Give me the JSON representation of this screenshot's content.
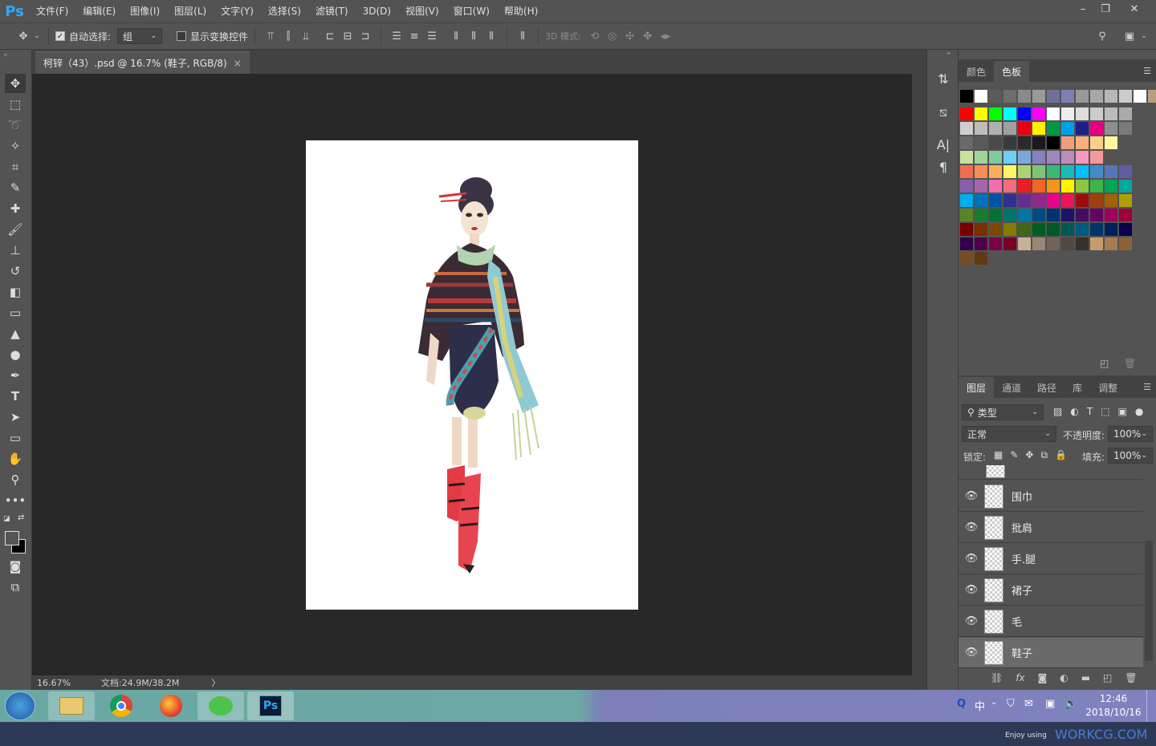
{
  "app": {
    "logo": "Ps"
  },
  "menubar": {
    "items": [
      "文件(F)",
      "编辑(E)",
      "图像(I)",
      "图层(L)",
      "文字(Y)",
      "选择(S)",
      "滤镜(T)",
      "3D(D)",
      "视图(V)",
      "窗口(W)",
      "帮助(H)"
    ]
  },
  "window_controls": {
    "minimize": "–",
    "restore": "❐",
    "close": "✕"
  },
  "options": {
    "auto_select_label": "自动选择:",
    "auto_select_value": "组",
    "show_transform_label": "显示变换控件",
    "mode_3d_label": "3D 模式:"
  },
  "document": {
    "tab_title": "柯锌（43）.psd @ 16.7% (鞋子, RGB/8)",
    "close": "×"
  },
  "status": {
    "zoom": "16.67%",
    "doc_info": "文档:24.9M/38.2M",
    "arrow": "〉"
  },
  "swatch_panel": {
    "tabs": [
      "颜色",
      "色板"
    ],
    "active_tab": "色板",
    "colors": [
      [
        "#000000",
        "#ffffff",
        "#5a5a5a",
        "#6e6e6e",
        "#8a8a8a",
        "#9a9a9a",
        "#6f6f9a",
        "#7e7eb8",
        "#999999",
        "#a8a8a8",
        "#b7b7b7",
        "#cccccc",
        "#ffffff",
        "#b8a07e"
      ],
      [
        "#ff0000",
        "#ffff00",
        "#00ff00",
        "#00ffff",
        "#0000ff",
        "#ff00ff",
        "#ffffff",
        "#eeeeee",
        "#dddddd",
        "#cccccc",
        "#bbbbbb",
        "#aaaaaa"
      ],
      [
        "#cfcfcf",
        "#bdbdbd",
        "#b0b0b0",
        "#a0a0a0",
        "#e60012",
        "#fff100",
        "#009944",
        "#00a0e9",
        "#1d2088",
        "#e4007f",
        "#8f8f8f",
        "#7a7a7a"
      ],
      [
        "#6a6a6a",
        "#5a5a5a",
        "#4a4a4a",
        "#3a3a3a",
        "#2a2a2a",
        "#1a1a1a",
        "#000000",
        "#f19e7e",
        "#f7b17a",
        "#fbcf8a",
        "#fff79a"
      ],
      [
        "#c7e29b",
        "#a3d39c",
        "#7fcaa0",
        "#6dcff6",
        "#7da7d9",
        "#8781bd",
        "#a186be",
        "#bd8cbf",
        "#f49ac1",
        "#f5989d"
      ],
      [
        "#f26c4f",
        "#f68e55",
        "#fbaf5d",
        "#fff468",
        "#acd373",
        "#7cc576",
        "#3bb878",
        "#1abbb4",
        "#00bff3",
        "#438ccb",
        "#5574b9",
        "#605ca8"
      ],
      [
        "#8560a8",
        "#a864a8",
        "#f06eaa",
        "#f26d7d",
        "#ed1c24",
        "#f26522",
        "#f7941d",
        "#fff200",
        "#8dc63f",
        "#39b54a",
        "#00a651",
        "#00a99d"
      ],
      [
        "#00aeef",
        "#0072bc",
        "#0054a6",
        "#2e3192",
        "#662d91",
        "#92278f",
        "#ec008c",
        "#ed145b",
        "#9e0b0f",
        "#a0410d",
        "#a36209",
        "#aba000"
      ],
      [
        "#598527",
        "#197b30",
        "#007236",
        "#00746b",
        "#0076a3",
        "#004b80",
        "#003471",
        "#1b1464",
        "#440e62",
        "#630460",
        "#9e005d",
        "#9e0039"
      ],
      [
        "#790000",
        "#7b2e00",
        "#7d4900",
        "#827b00",
        "#406618",
        "#005e20",
        "#005826",
        "#005952",
        "#005b7f",
        "#003663",
        "#002157",
        "#0d004c"
      ],
      [
        "#32004b",
        "#4b0049",
        "#7b0046",
        "#7a0026",
        "#c7b299",
        "#998675",
        "#736357",
        "#534741",
        "#37302d",
        "#c69c6d",
        "#a67c52",
        "#8c6239"
      ],
      [
        "#754c24",
        "#603913"
      ]
    ]
  },
  "layers_panel": {
    "tabs": [
      "图层",
      "通道",
      "路径",
      "库",
      "调整"
    ],
    "active_tab": "图层",
    "filter_label": "类型",
    "blend_mode": "正常",
    "opacity_label": "不透明度:",
    "opacity_value": "100%",
    "lock_label": "锁定:",
    "fill_label": "填充:",
    "fill_value": "100%",
    "layers": [
      {
        "name": "围巾",
        "selected": false
      },
      {
        "name": "批肩",
        "selected": false
      },
      {
        "name": "手.腿",
        "selected": false
      },
      {
        "name": "裙子",
        "selected": false
      },
      {
        "name": "毛",
        "selected": false
      },
      {
        "name": "鞋子",
        "selected": true
      }
    ],
    "fx_label": "fx"
  },
  "taskbar": {
    "time": "12:46",
    "date": "2018/10/16",
    "ime": "中",
    "watermark_prefix": "Enjoy using",
    "watermark_brand": "WORKCG.COM"
  }
}
